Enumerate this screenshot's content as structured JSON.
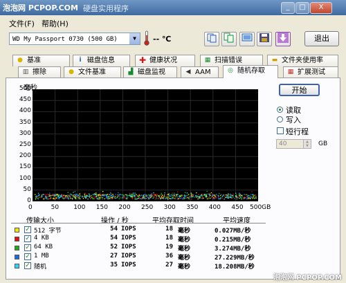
{
  "window": {
    "watermark": "泡泡网 PCPOP.COM",
    "title": "硬盘实用程序",
    "minimize": "_",
    "maximize": "□",
    "close": "X"
  },
  "menu": {
    "file": "文件(F)",
    "help": "帮助(H)"
  },
  "toolbar": {
    "drive": "WD      My Passport 0730 (500 GB)",
    "temperature": "-- ℃",
    "exit_label": "退出"
  },
  "tabs_row1": [
    "基准",
    "磁盘信息",
    "健康状况",
    "扫描错误",
    "文件夹使用率"
  ],
  "tabs_row2": [
    "擦除",
    "文件基准",
    "磁盘监视",
    "AAM",
    "随机存取",
    "扩展测试"
  ],
  "graph": {
    "y_title": "毫秒",
    "y_ticks": [
      "500",
      "450",
      "400",
      "350",
      "300",
      "250",
      "200",
      "150",
      "100",
      "50",
      "0"
    ],
    "x_ticks": [
      "0",
      "50",
      "100",
      "150",
      "200",
      "250",
      "300",
      "350",
      "400",
      "450",
      "500GB"
    ]
  },
  "controls": {
    "start_label": "开始",
    "read_label": "读取",
    "write_label": "写入",
    "short_stroke_label": "短行程",
    "short_stroke_value": "40",
    "unit": "GB"
  },
  "table": {
    "headers": [
      "传输大小",
      "操作 / 秒",
      "平均存取时间",
      "平均速度"
    ],
    "rows": [
      {
        "name": "512 字节",
        "ops": "54",
        "ops_unit": "IOPS",
        "time": "18",
        "time_unit": "毫秒",
        "speed": "0.027MB/秒",
        "color": "#f5e600"
      },
      {
        "name": "4 KB",
        "ops": "54",
        "ops_unit": "IOPS",
        "time": "18",
        "time_unit": "毫秒",
        "speed": "0.215MB/秒",
        "color": "#e01010"
      },
      {
        "name": "64 KB",
        "ops": "52",
        "ops_unit": "IOPS",
        "time": "19",
        "time_unit": "毫秒",
        "speed": "3.274MB/秒",
        "color": "#18b018"
      },
      {
        "name": "1 MB",
        "ops": "27",
        "ops_unit": "IOPS",
        "time": "36",
        "time_unit": "毫秒",
        "speed": "27.229MB/秒",
        "color": "#1a6fe0"
      },
      {
        "name": "随机",
        "ops": "35",
        "ops_unit": "IOPS",
        "time": "27",
        "time_unit": "毫秒",
        "speed": "18.208MB/秒",
        "color": "#30d0ff"
      }
    ]
  }
}
